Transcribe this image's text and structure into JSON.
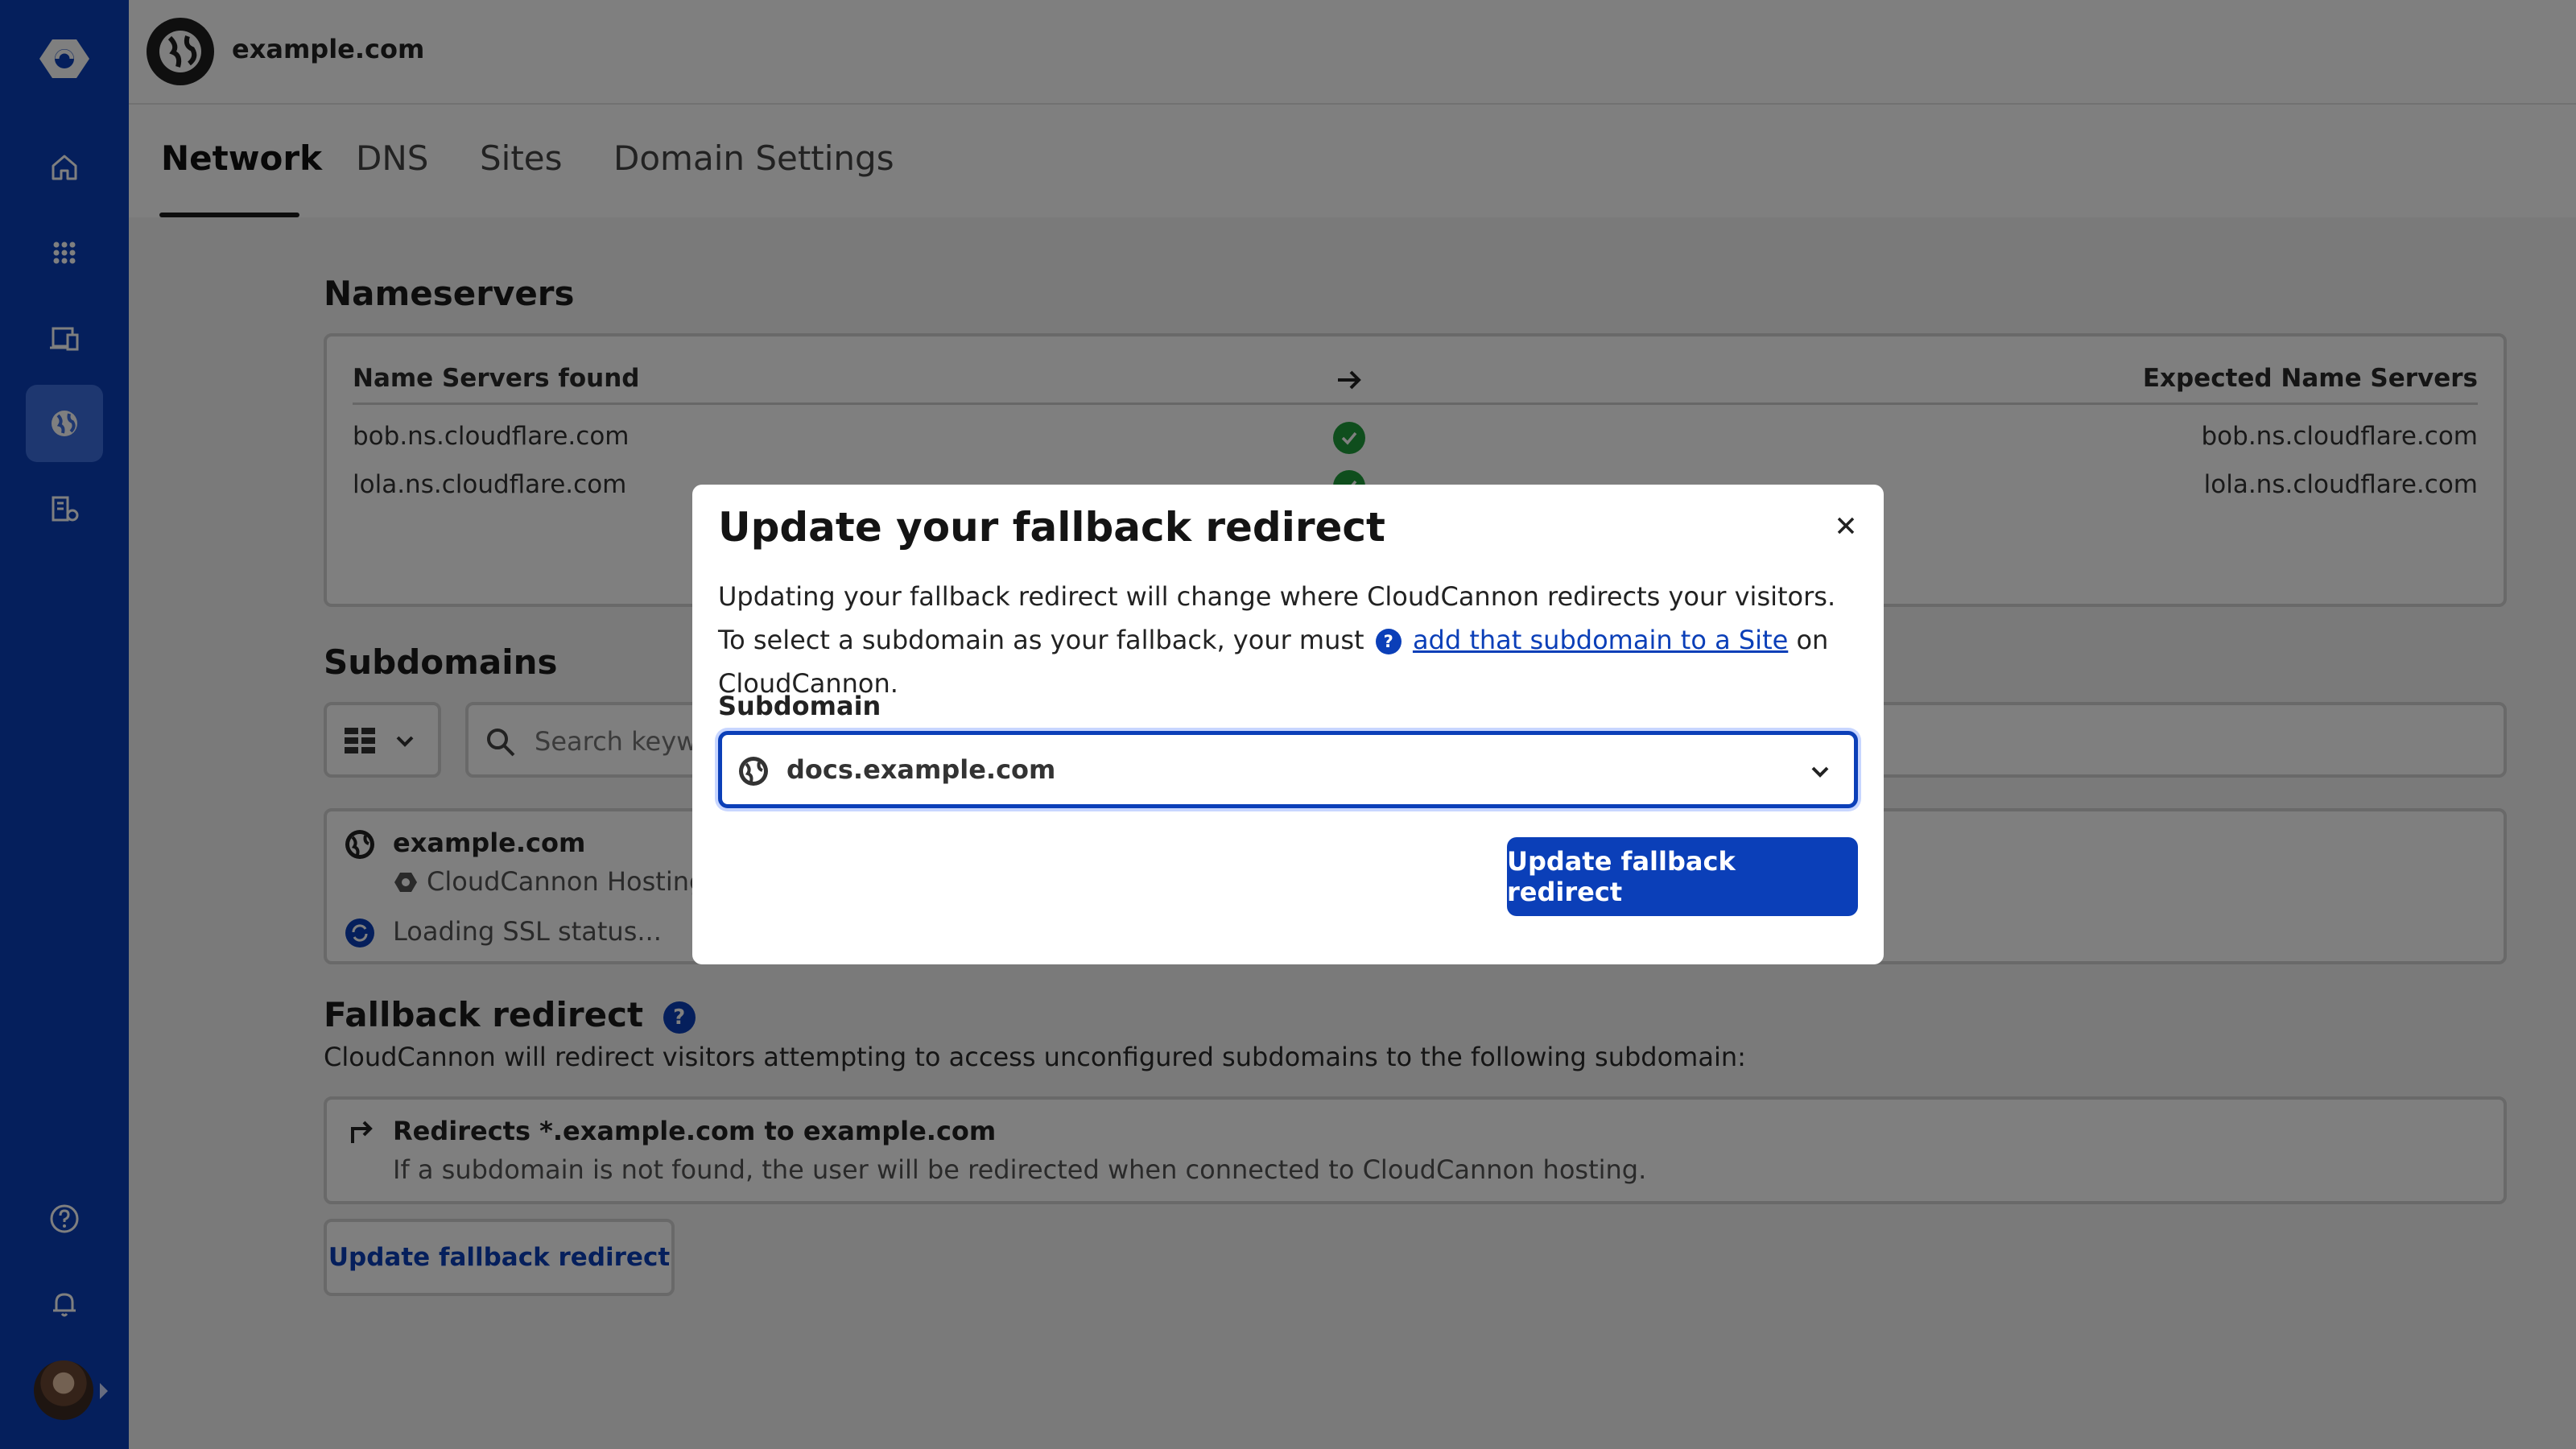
{
  "site": {
    "name": "example.com"
  },
  "tabs": [
    "Network",
    "DNS",
    "Sites",
    "Domain Settings"
  ],
  "nameservers": {
    "title": "Nameservers",
    "found_header": "Name Servers found",
    "expected_header": "Expected Name Servers",
    "rows": [
      {
        "found": "bob.ns.cloudflare.com",
        "expected": "bob.ns.cloudflare.com"
      },
      {
        "found": "lola.ns.cloudflare.com",
        "expected": "lola.ns.cloudflare.com"
      }
    ]
  },
  "subdomains": {
    "title": "Subdomains",
    "search_placeholder": "Search keywo",
    "item": {
      "name": "example.com",
      "hosting": "CloudCannon Hosting",
      "ssl": "Loading SSL status..."
    }
  },
  "fallback": {
    "title": "Fallback redirect",
    "description": "CloudCannon will redirect visitors attempting to access unconfigured subdomains to the following subdomain:",
    "redirect_title": "Redirects *.example.com to example.com",
    "redirect_note": "If a subdomain is not found, the user will be redirected when connected to CloudCannon hosting.",
    "button": "Update fallback redirect"
  },
  "modal": {
    "title": "Update your fallback redirect",
    "body_before": "Updating your fallback redirect will change where CloudCannon redirects your visitors. To select a subdomain as your fallback, your must",
    "link": "add that subdomain to a Site",
    "body_after": "on CloudCannon.",
    "label": "Subdomain",
    "selected": "docs.example.com",
    "button": "Update fallback redirect"
  },
  "icons": [
    "cloudcannon-logo-icon",
    "home-icon",
    "apps-grid-icon",
    "devices-icon",
    "globe-icon",
    "organization-settings-icon",
    "help-icon",
    "bell-icon",
    "avatar",
    "check-icon",
    "arrow-right-icon",
    "grid-view-icon",
    "chevron-down-icon",
    "search-icon",
    "redirect-arrow-icon",
    "close-icon",
    "sync-icon"
  ],
  "colors": {
    "brand": "#0b3fb8",
    "success": "#1f9d3a"
  }
}
